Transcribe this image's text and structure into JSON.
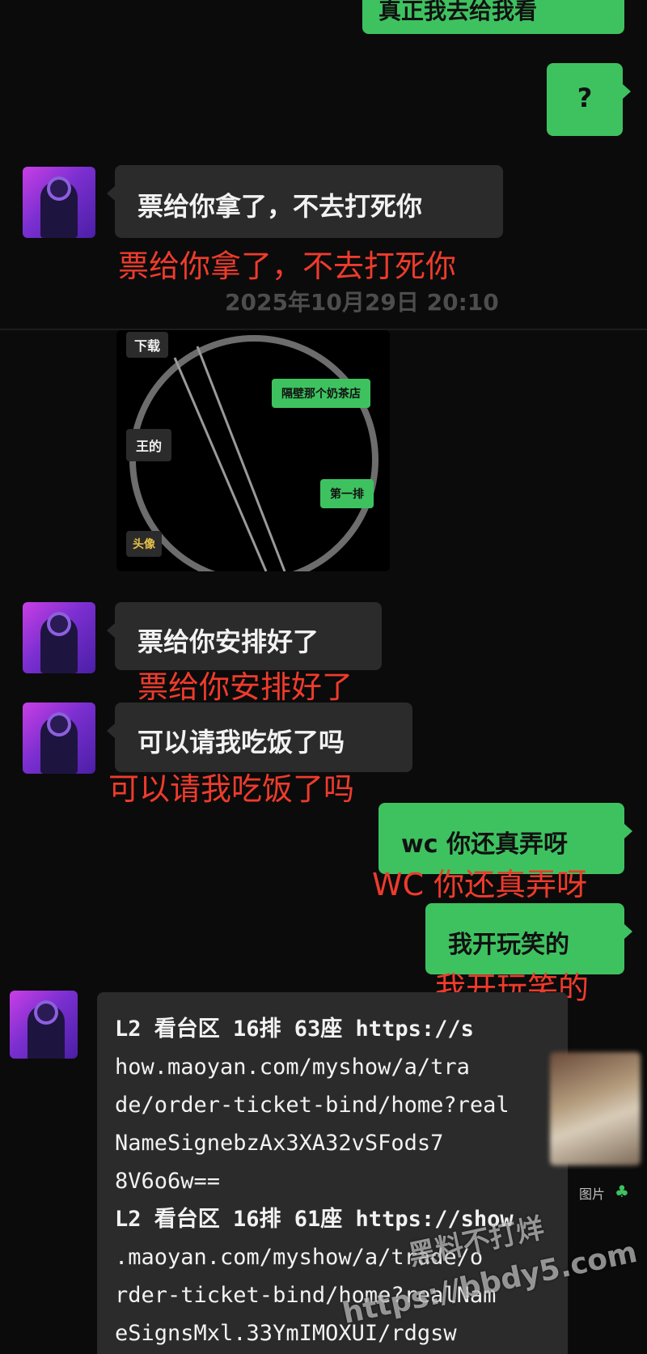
{
  "messages": {
    "top_partial": "真正我去给我看",
    "question": "?",
    "m1_bubble": "票给你拿了，不去打死你",
    "m1_caption": "票给你拿了，不去打死你",
    "timestamp": "2025年10月29日 20:10",
    "image_labels": {
      "top_left": "下载",
      "middle_left": "王的",
      "green_1": "隔壁那个奶茶店",
      "green_2": "第一排",
      "bottom_left": "头像"
    },
    "m2_bubble": "票给你安排好了",
    "m2_caption": "票给你安排好了",
    "m3_bubble": "可以请我吃饭了吗",
    "m3_caption": "可以请我吃饭了吗",
    "m4_bubble": "wc 你还真弄呀",
    "m4_caption": "WC 你还真弄呀",
    "m5_bubble": "我开玩笑的",
    "m5_caption": "我开玩笑的",
    "ticket_lines": [
      "L2 看台区 16排 63座   https://s",
      "how.maoyan.com/myshow/a/tra",
      "de/order-ticket-bind/home?real",
      "NameSignebzAx3XA32vSFods7",
      "8V6o6w==",
      "L2 看台区 16排 61座 https://show",
      ".maoyan.com/myshow/a/trade/o",
      "rder-ticket-bind/home?realNam",
      "eSignsMxl.33YmIMOXUI/rdgsw"
    ],
    "thumb_label": "图片"
  },
  "watermark": {
    "line1": "黑料不打烊",
    "line2": "https://bbdy5.com"
  },
  "colors": {
    "background": "#0b0b0b",
    "gray_bubble": "#2b2b2b",
    "green_bubble": "#3ec260",
    "caption_red": "#ef3b2c"
  }
}
